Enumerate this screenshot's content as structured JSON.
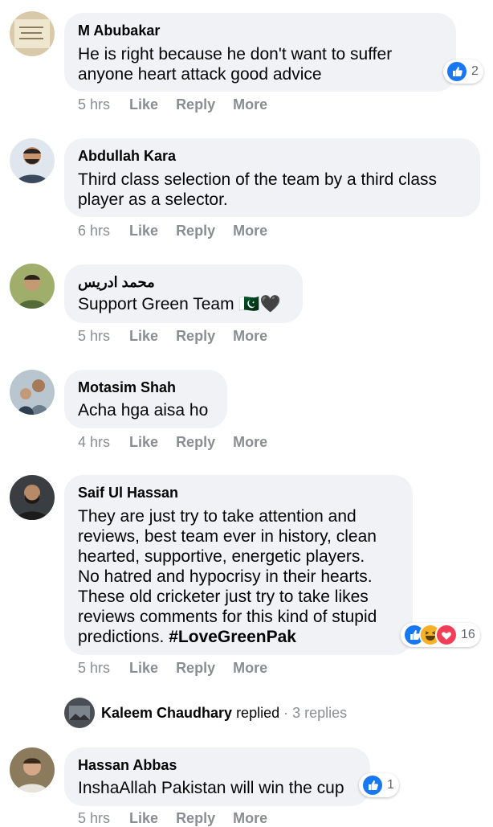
{
  "actions": {
    "like": "Like",
    "reply": "Reply",
    "more": "More"
  },
  "colors": {
    "bubble": "#f0f2f5",
    "like_blue": "#1877f2",
    "love_red": "#f33e58",
    "haha_yellow": "#f7b125",
    "meta_gray": "#8a8d91"
  },
  "comments": [
    {
      "name": "M Abubakar",
      "text": "He is right because he don't want to suffer\nanyone heart attack good advice",
      "time": "5 hrs",
      "reactions": [
        "like-icon"
      ],
      "reaction_count": "2"
    },
    {
      "name": "Abdullah Kara",
      "text": "Third class selection of the team by a third class\nplayer as a selector.",
      "time": "6 hrs"
    },
    {
      "name": "محمد ادریس",
      "text": "Support Green Team 🇵🇰🖤",
      "time": "5 hrs"
    },
    {
      "name": "Motasim Shah",
      "text": "Acha hga aisa ho",
      "time": "4 hrs"
    },
    {
      "name": "Saif Ul Hassan",
      "text": "They are just try to take attention and\nreviews, best team ever in history, clean\nhearted, supportive, energetic players.\nNo hatred and hypocrisy in their hearts.\nThese old cricketer just try to take likes\nreviews comments for this kind of stupid\npredictions. ",
      "hashtag": "#LoveGreenPak",
      "time": "5 hrs",
      "reactions": [
        "like-icon",
        "haha-icon",
        "love-icon"
      ],
      "reaction_count": "16"
    },
    {
      "name": "Hassan Abbas",
      "text": "InshaAllah Pakistan will win the cup",
      "time": "5 hrs",
      "reactions": [
        "like-icon"
      ],
      "reaction_count": "1"
    }
  ],
  "reply_thread": {
    "name": "Kaleem Chaudhary",
    "replied": "replied",
    "dot": "·",
    "count": "3 replies"
  }
}
